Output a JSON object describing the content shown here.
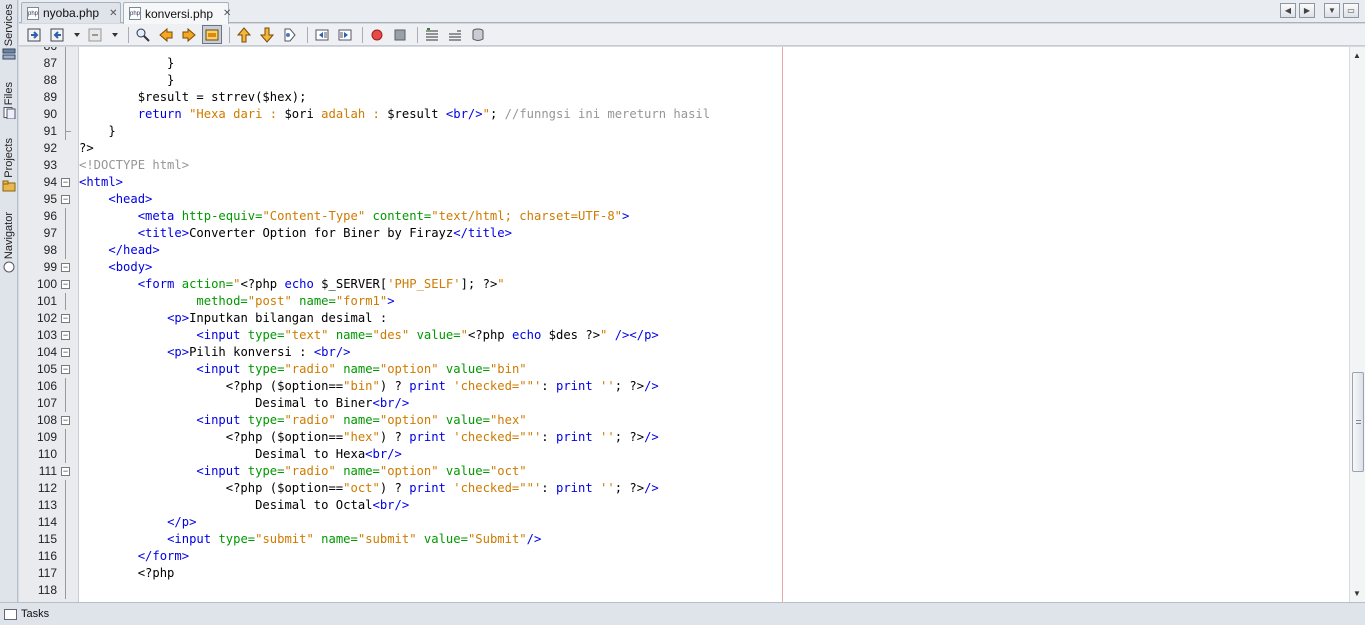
{
  "sidebar": {
    "tabs": [
      {
        "label": "Services",
        "icon": "services-icon"
      },
      {
        "label": "Files",
        "icon": "files-icon"
      },
      {
        "label": "Projects",
        "icon": "projects-icon"
      },
      {
        "label": "Navigator",
        "icon": "navigator-icon"
      }
    ]
  },
  "editor_tabs": [
    {
      "label": "nyoba.php",
      "active": false
    },
    {
      "label": "konversi.php",
      "active": true
    }
  ],
  "bottom": {
    "tasks_label": "Tasks"
  },
  "editor": {
    "lines": [
      {
        "n": "86",
        "html": ""
      },
      {
        "n": "87",
        "html": "            }"
      },
      {
        "n": "88",
        "html": "            }"
      },
      {
        "n": "89",
        "html": "        $result = strrev($hex);"
      },
      {
        "n": "90",
        "html": "        <span class='k'>return</span> <span class='s'>\"Hexa dari : </span>$ori<span class='s'> adalah : </span>$result<span class='s'> </span><span class='t'>&lt;br/&gt;</span><span class='s'>\"</span>; <span class='c'>//funngsi ini mereturn hasil</span>"
      },
      {
        "n": "91",
        "html": "    }"
      },
      {
        "n": "92",
        "html": "?&gt;"
      },
      {
        "n": "93",
        "html": "<span class='c'>&lt;!DOCTYPE html&gt;</span>"
      },
      {
        "n": "94",
        "html": "<span class='t'>&lt;html&gt;</span>"
      },
      {
        "n": "95",
        "html": "    <span class='t'>&lt;head&gt;</span>"
      },
      {
        "n": "96",
        "html": "        <span class='t'>&lt;meta</span> <span class='a'>http-equiv=</span><span class='s'>\"Content-Type\"</span> <span class='a'>content=</span><span class='s'>\"text/html; charset=UTF-8\"</span><span class='t'>&gt;</span>"
      },
      {
        "n": "97",
        "html": "        <span class='t'>&lt;title&gt;</span>Converter Option for Biner by Firayz<span class='t'>&lt;/title&gt;</span>"
      },
      {
        "n": "98",
        "html": "    <span class='t'>&lt;/head&gt;</span>"
      },
      {
        "n": "99",
        "html": "    <span class='t'>&lt;body&gt;</span>"
      },
      {
        "n": "100",
        "html": "        <span class='t'>&lt;form</span> <span class='a'>action=</span><span class='s'>\"</span>&lt;?php <span class='k'>echo</span> $_SERVER[<span class='s'>'PHP_SELF'</span>]; ?&gt;<span class='s'>\"</span>"
      },
      {
        "n": "101",
        "html": "                <span class='a'>method=</span><span class='s'>\"post\"</span> <span class='a'>name=</span><span class='s'>\"form1\"</span><span class='t'>&gt;</span>"
      },
      {
        "n": "102",
        "html": "            <span class='t'>&lt;p&gt;</span>Inputkan bilangan desimal :"
      },
      {
        "n": "103",
        "html": "                <span class='t'>&lt;input</span> <span class='a'>type=</span><span class='s'>\"text\"</span> <span class='a'>name=</span><span class='s'>\"des\"</span> <span class='a'>value=</span><span class='s'>\"</span>&lt;?php <span class='k'>echo</span> $des ?&gt;<span class='s'>\"</span> <span class='t'>/&gt;&lt;/p&gt;</span>"
      },
      {
        "n": "104",
        "html": "            <span class='t'>&lt;p&gt;</span>Pilih konversi : <span class='t'>&lt;br/&gt;</span>"
      },
      {
        "n": "105",
        "html": "                <span class='t'>&lt;input</span> <span class='a'>type=</span><span class='s'>\"radio\"</span> <span class='a'>name=</span><span class='s'>\"option\"</span> <span class='a'>value=</span><span class='s'>\"bin\"</span>"
      },
      {
        "n": "106",
        "html": "                    &lt;?php ($option==<span class='s'>\"bin\"</span>) ? <span class='k'>print</span> <span class='s'>'checked=\"\"'</span>: <span class='k'>print</span> <span class='s'>''</span>; ?&gt;<span class='t'>/&gt;</span>"
      },
      {
        "n": "107",
        "html": "                        Desimal to Biner<span class='t'>&lt;br/&gt;</span>"
      },
      {
        "n": "108",
        "html": "                <span class='t'>&lt;input</span> <span class='a'>type=</span><span class='s'>\"radio\"</span> <span class='a'>name=</span><span class='s'>\"option\"</span> <span class='a'>value=</span><span class='s'>\"hex\"</span>"
      },
      {
        "n": "109",
        "html": "                    &lt;?php ($option==<span class='s'>\"hex\"</span>) ? <span class='k'>print</span> <span class='s'>'checked=\"\"'</span>: <span class='k'>print</span> <span class='s'>''</span>; ?&gt;<span class='t'>/&gt;</span>"
      },
      {
        "n": "110",
        "html": "                        Desimal to Hexa<span class='t'>&lt;br/&gt;</span>"
      },
      {
        "n": "111",
        "html": "                <span class='t'>&lt;input</span> <span class='a'>type=</span><span class='s'>\"radio\"</span> <span class='a'>name=</span><span class='s'>\"option\"</span> <span class='a'>value=</span><span class='s'>\"oct\"</span>"
      },
      {
        "n": "112",
        "html": "                    &lt;?php ($option==<span class='s'>\"oct\"</span>) ? <span class='k'>print</span> <span class='s'>'checked=\"\"'</span>: <span class='k'>print</span> <span class='s'>''</span>; ?&gt;<span class='t'>/&gt;</span>"
      },
      {
        "n": "113",
        "html": "                        Desimal to Octal<span class='t'>&lt;br/&gt;</span>"
      },
      {
        "n": "114",
        "html": "            <span class='t'>&lt;/p&gt;</span>"
      },
      {
        "n": "115",
        "html": "            <span class='t'>&lt;input</span> <span class='a'>type=</span><span class='s'>\"submit\"</span> <span class='a'>name=</span><span class='s'>\"submit\"</span> <span class='a'>value=</span><span class='s'>\"Submit\"</span><span class='t'>/&gt;</span>"
      },
      {
        "n": "116",
        "html": "        <span class='t'>&lt;/form&gt;</span>"
      },
      {
        "n": "117",
        "html": "        &lt;?php"
      },
      {
        "n": "118",
        "html": ""
      }
    ]
  }
}
